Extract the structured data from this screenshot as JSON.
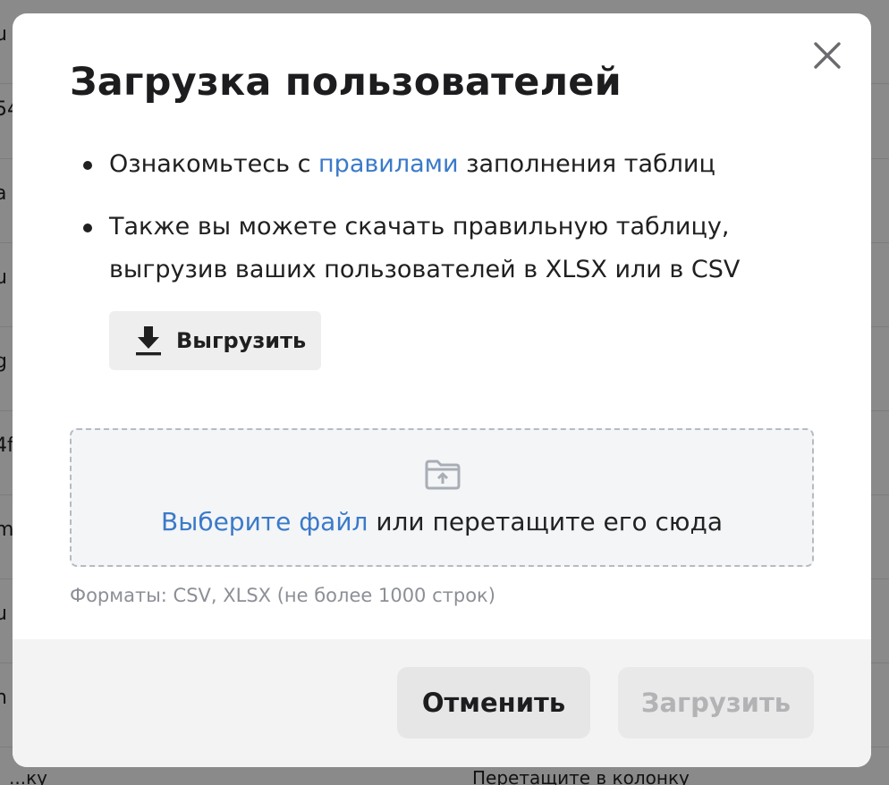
{
  "background": {
    "rows": [
      "u",
      "54",
      "a",
      "u",
      "g",
      "4f",
      "m",
      "u",
      "n"
    ],
    "bottom_left": "...ку",
    "bottom_right": "Перетащите в колонку"
  },
  "modal": {
    "title": "Загрузка пользователей",
    "close_icon": "close-icon",
    "bullets": {
      "first": {
        "prefix": "Ознакомьтесь с ",
        "link": "правилами",
        "suffix": " заполнения таблиц"
      },
      "second": {
        "text": "Также вы можете скачать правильную таблицу, выгрузив ваших пользователей в XLSX или в CSV"
      }
    },
    "export_button": {
      "label": "Выгрузить",
      "icon": "download-icon"
    },
    "dropzone": {
      "icon": "folder-upload-icon",
      "link": "Выберите файл",
      "text": " или перетащите его сюда"
    },
    "formats_hint": "Форматы: CSV, XLSX (не более 1000 строк)",
    "footer": {
      "cancel_label": "Отменить",
      "upload_label": "Загрузить"
    }
  },
  "colors": {
    "link": "#3a7ac9",
    "overlay": "rgba(0,0,0,0.46)",
    "disabled_text": "#b3b3b5"
  }
}
